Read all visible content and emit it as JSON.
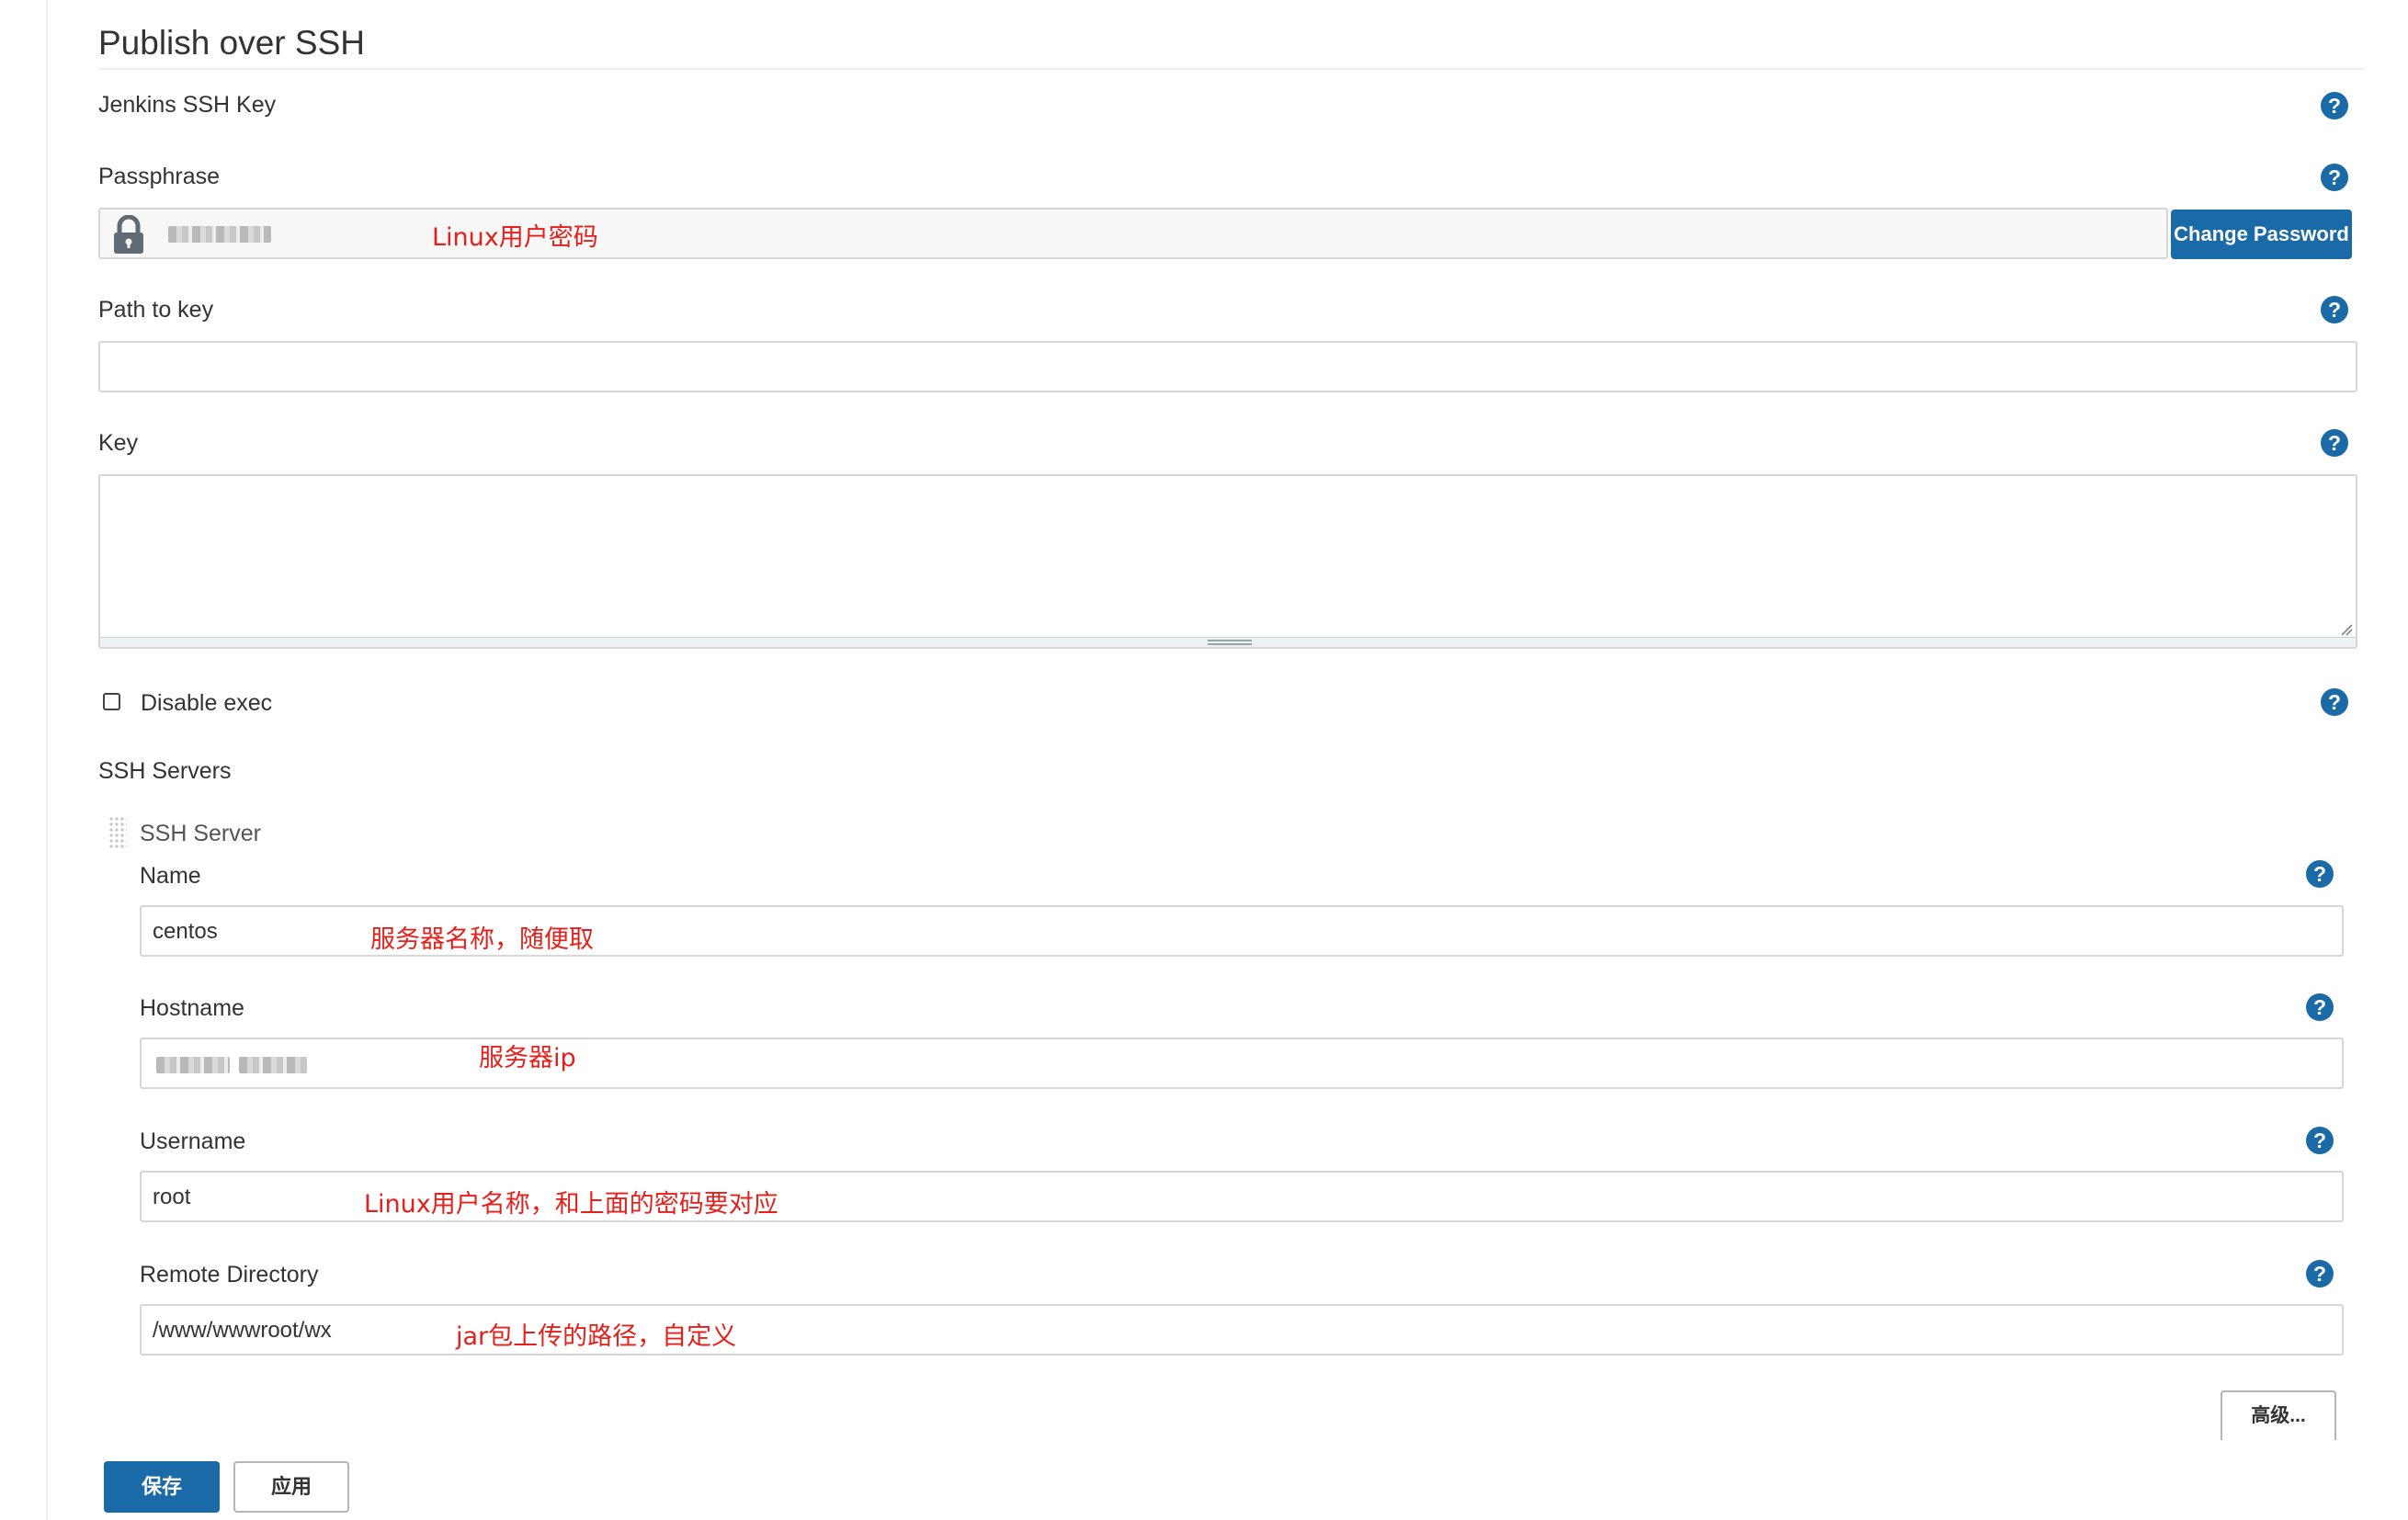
{
  "section_title": "Publish over SSH",
  "fields": {
    "ssh_key_label": "Jenkins SSH Key",
    "passphrase_label": "Passphrase",
    "change_password_label": "Change Password",
    "path_to_key_label": "Path to key",
    "path_to_key_value": "",
    "key_label": "Key",
    "key_value": "",
    "disable_exec_label": "Disable exec",
    "disable_exec_checked": false
  },
  "ssh_servers": {
    "label": "SSH Servers",
    "server_header": "SSH Server",
    "name_label": "Name",
    "name_value": "centos",
    "hostname_label": "Hostname",
    "username_label": "Username",
    "username_value": "root",
    "remote_dir_label": "Remote Directory",
    "remote_dir_value": "/www/wwwroot/wx",
    "advanced_label": "高级..."
  },
  "annotations": {
    "passphrase_note": "Linux用户密码",
    "name_note": "服务器名称，随便取",
    "hostname_note": "服务器ip",
    "username_note": "Linux用户名称，和上面的密码要对应",
    "remote_dir_note": "jar包上传的路径，自定义"
  },
  "footer": {
    "save_label": "保存",
    "apply_label": "应用"
  },
  "icons": {
    "help": "help-icon",
    "lock": "lock-icon",
    "drag": "drag-handle-icon"
  },
  "colors": {
    "primary": "#1a6aa7",
    "annotation": "#e3201b"
  }
}
